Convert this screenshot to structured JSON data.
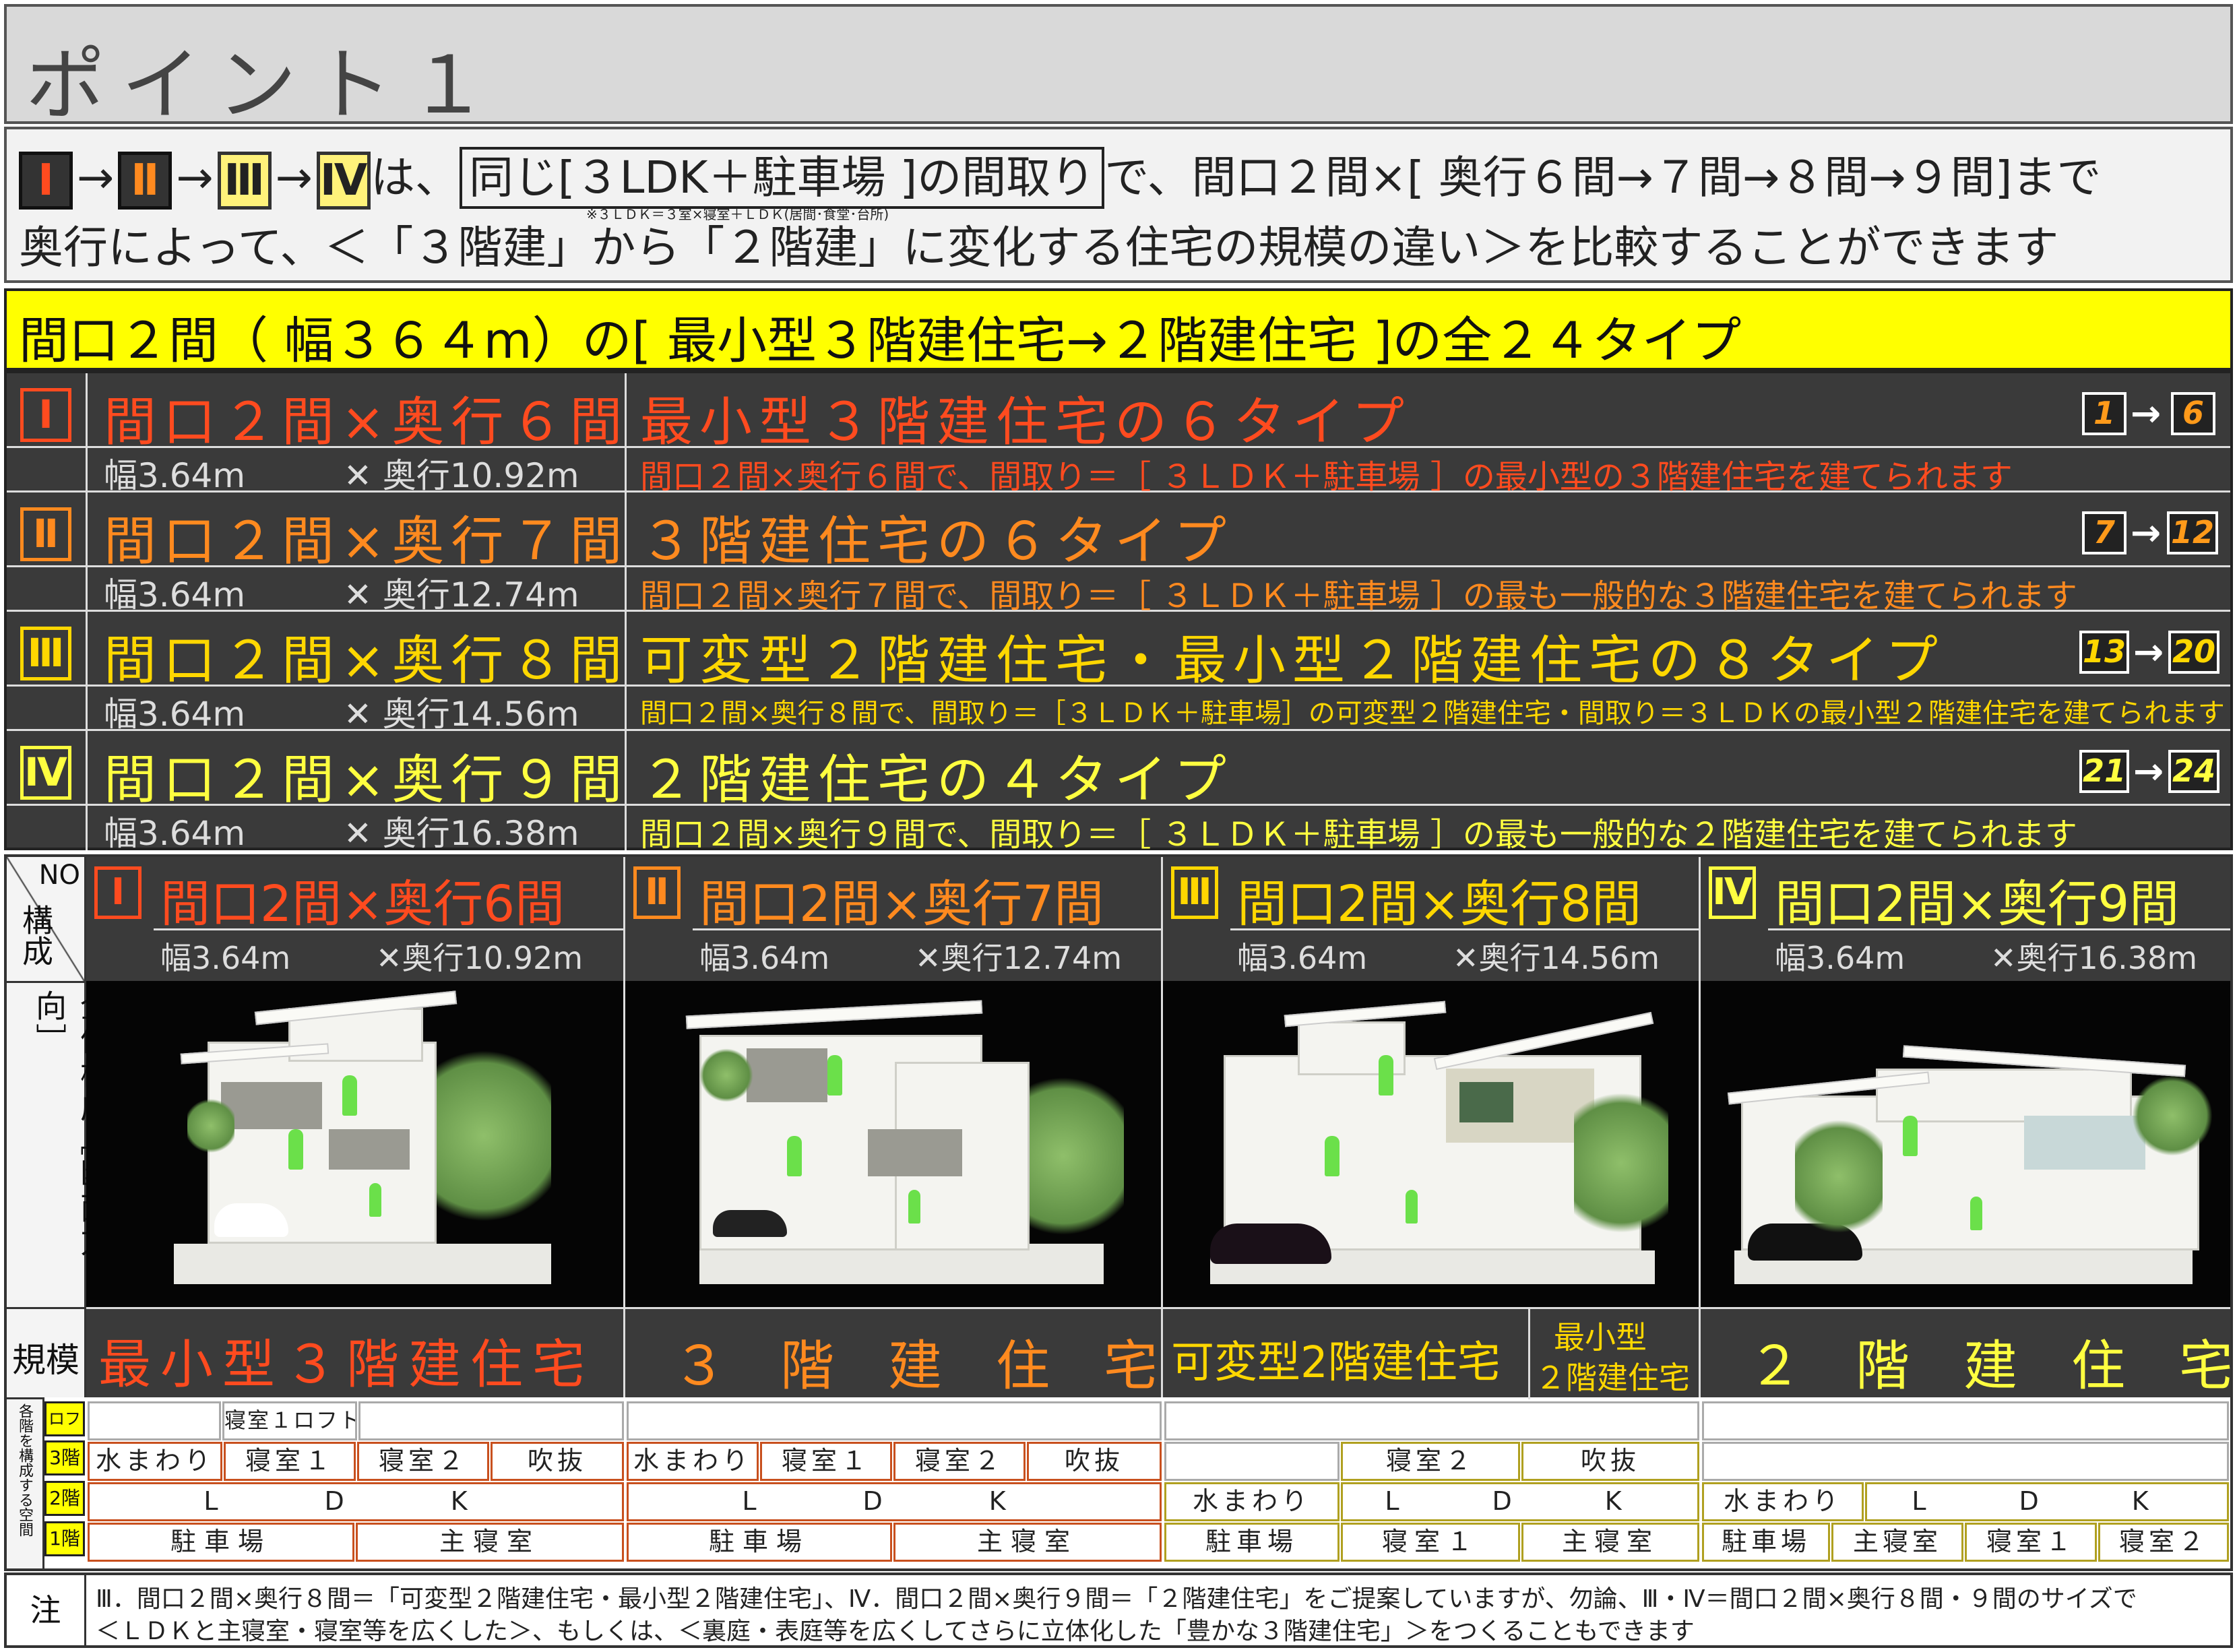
{
  "title": "ポイント１",
  "intro": {
    "romans": [
      "Ⅰ",
      "Ⅱ",
      "Ⅲ",
      "Ⅳ"
    ],
    "arrow": "→",
    "line1_a": "は、",
    "line1_boxed": "同じ[３LDK＋駐車場 ]の間取り",
    "line1_b": "で、間口２間×[ 奥行６間→７間→８間→９間]まで",
    "small_note": "※３ＬＤＫ＝３室×寝室＋ＬＤＫ(居間･食堂･台所)",
    "line2": "奥行によって、＜「３階建」から「２階建」に変化する住宅の規模の違い＞を比較することができます"
  },
  "banner": "間口２間（ 幅３６４m）の[ 最小型３階建住宅→２階建住宅 ]の全２４タイプ",
  "rows": [
    {
      "num": "Ⅰ",
      "name": "間口２間×奥行６間",
      "width": "幅3.64m",
      "depth": "✕ 奥行10.92m",
      "type": "最小型３階建住宅の６タイプ",
      "desc": "間口２間×奥行６間で、間取り＝［ ３ＬＤＫ＋駐車場 ］の最小型の３階建住宅を建てられます",
      "from": "1",
      "to": "6"
    },
    {
      "num": "Ⅱ",
      "name": "間口２間×奥行７間",
      "width": "幅3.64m",
      "depth": "✕ 奥行12.74m",
      "type": "３階建住宅の６タイプ",
      "desc": "間口２間×奥行７間で、間取り＝［ ３ＬＤＫ＋駐車場 ］の最も一般的な３階建住宅を建てられます",
      "from": "7",
      "to": "12"
    },
    {
      "num": "Ⅲ",
      "name": "間口２間×奥行８間",
      "width": "幅3.64m",
      "depth": "✕ 奥行14.56m",
      "type": "可変型２階建住宅・最小型２階建住宅の８タイプ",
      "desc": "間口２間×奥行８間で、間取り＝［３ＬＤＫ＋駐車場］の可変型２階建住宅・間取り＝３ＬＤＫの最小型２階建住宅を建てられます",
      "from": "13",
      "to": "20"
    },
    {
      "num": "Ⅳ",
      "name": "間口２間×奥行９間",
      "width": "幅3.64m",
      "depth": "✕ 奥行16.38m",
      "type": "２階建住宅の４タイプ",
      "desc": "間口２間×奥行９間で、間取り＝［ ３ＬＤＫ＋駐車場 ］の最も一般的な２階建住宅を建てられます",
      "from": "21",
      "to": "24"
    }
  ],
  "grid": {
    "no": "NO",
    "kousei": "構成",
    "zentai": "全体構成［断面方向］",
    "kibo": "規模",
    "floors_label": "各階を構成する空間",
    "floor_names": [
      "ロフト",
      "3階",
      "2階",
      "1階"
    ],
    "cols": [
      {
        "num": "Ⅰ",
        "name": "間口2間×奥行6間",
        "width": "幅3.64m",
        "depth": "✕奥行10.92m"
      },
      {
        "num": "Ⅱ",
        "name": "間口2間×奥行7間",
        "width": "幅3.64m",
        "depth": "✕奥行12.74m"
      },
      {
        "num": "Ⅲ",
        "name": "間口2間×奥行8間",
        "width": "幅3.64m",
        "depth": "✕奥行14.56m"
      },
      {
        "num": "Ⅳ",
        "name": "間口2間×奥行9間",
        "width": "幅3.64m",
        "depth": "✕奥行16.38m"
      }
    ],
    "scale1": "最小型３階建住宅",
    "scale2": "３　階　建　住　宅",
    "scale3a": "可変型2階建住宅",
    "scale3b_1": "最小型",
    "scale3b_2": "２階建住宅",
    "scale4": "２　階　建　住　宅",
    "c1": {
      "loft": "寝室１ロフト",
      "f3": [
        "水まわり",
        "寝室１",
        "寝室２",
        "吹抜"
      ],
      "f2": "L　D　K",
      "f1": [
        "駐車場",
        "主寝室"
      ]
    },
    "c2": {
      "f3": [
        "水まわり",
        "寝室１",
        "寝室２",
        "吹抜"
      ],
      "f2": "L　D　K",
      "f1": [
        "駐車場",
        "主寝室"
      ]
    },
    "c3": {
      "f3": [
        "寝室２",
        "吹抜"
      ],
      "f2": [
        "水まわり",
        "L　D　K"
      ],
      "f1": [
        "駐車場",
        "寝室１",
        "主寝室"
      ]
    },
    "c4": {
      "f2": [
        "水まわり",
        "L　D　K"
      ],
      "f1": [
        "駐車場",
        "主寝室",
        "寝室１",
        "寝室２"
      ]
    }
  },
  "note": {
    "label": "注",
    "line1": "Ⅲ．間口２間×奥行８間＝「可変型２階建住宅・最小型２階建住宅」、Ⅳ．間口２間×奥行９間＝「２階建住宅」をご提案していますが、勿論、Ⅲ・Ⅳ＝間口２間×奥行８間・９間のサイズで",
    "line2": "＜ＬＤＫと主寝室・寝室等を広くした＞、もしくは、＜裏庭・表庭等を広くしてさらに立体化した「豊かな３階建住宅」＞をつくることもできます"
  }
}
